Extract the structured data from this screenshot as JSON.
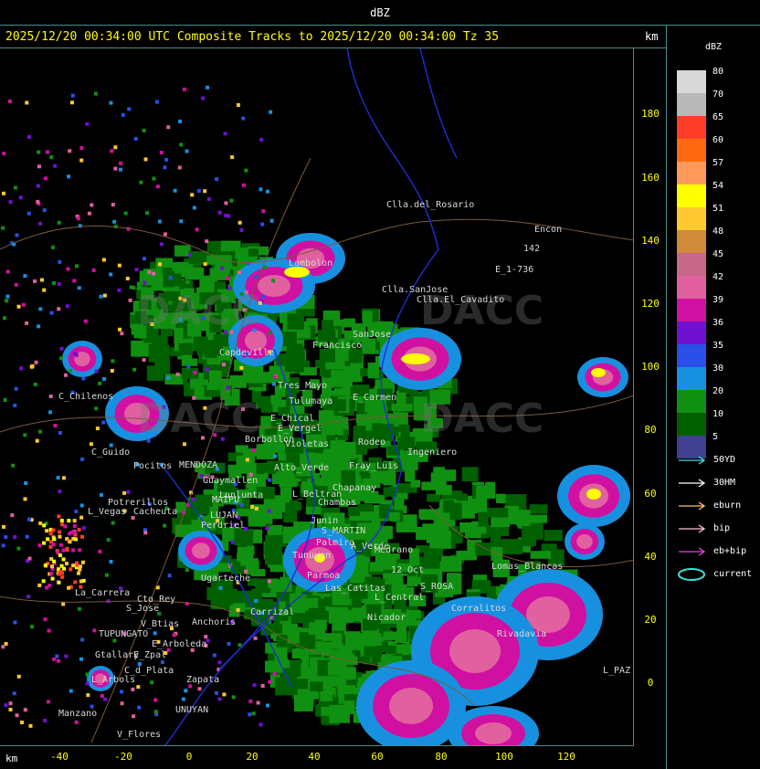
{
  "window": {
    "title": "dBZ"
  },
  "header": {
    "title": "2025/12/20 00:34:00 UTC Composite Tracks to 2025/12/20 00:34:00 Tz 35",
    "unit_top": "km",
    "unit_bottom": "km"
  },
  "axes": {
    "y_ticks": [
      "180",
      "160",
      "140",
      "120",
      "100",
      "80",
      "60",
      "40",
      "20",
      "0"
    ],
    "x_ticks": [
      "-40",
      "-20",
      "0",
      "20",
      "40",
      "60",
      "80",
      "100",
      "120"
    ]
  },
  "legend": {
    "title": "dBZ",
    "levels": [
      {
        "label": "80",
        "color": "#d8d8d8"
      },
      {
        "label": "70",
        "color": "#b8b8b8"
      },
      {
        "label": "65",
        "color": "#ff3c28"
      },
      {
        "label": "60",
        "color": "#ff6a10"
      },
      {
        "label": "57",
        "color": "#ff9a5a"
      },
      {
        "label": "54",
        "color": "#ffff00"
      },
      {
        "label": "51",
        "color": "#ffc830"
      },
      {
        "label": "48",
        "color": "#d08a3a"
      },
      {
        "label": "45",
        "color": "#c86888"
      },
      {
        "label": "42",
        "color": "#e060a0"
      },
      {
        "label": "39",
        "color": "#d010a0"
      },
      {
        "label": "36",
        "color": "#7010d0"
      },
      {
        "label": "35",
        "color": "#2850e8"
      },
      {
        "label": "30",
        "color": "#1890e0"
      },
      {
        "label": "20",
        "color": "#109010"
      },
      {
        "label": "10",
        "color": "#006000"
      },
      {
        "label": "5",
        "color": "#404090"
      }
    ],
    "tracks": [
      {
        "label": "50YD",
        "color": "#40e0e0"
      },
      {
        "label": "30HM",
        "color": "#ffffff"
      },
      {
        "label": "eburn",
        "color": "#ffc070"
      },
      {
        "label": "bip",
        "color": "#ffc0e0"
      },
      {
        "label": "eb+bip",
        "color": "#e040e0"
      },
      {
        "label": "current",
        "color": "#40e0e0"
      }
    ]
  },
  "watermark": {
    "text": "DACC"
  },
  "places": [
    "Clla.del_Rosario",
    "Encon",
    "E_1-736",
    "142",
    "Clla.SanJose",
    "Clla.El_Cavadito",
    "Lambolon",
    "SanJose",
    "Francisco",
    "Capdeville",
    "Tres_Mayo",
    "Tulumaya",
    "E_Carmen",
    "C_Chilenos",
    "E_Chical",
    "E_Vergel",
    "Borbollon",
    "Violetas",
    "Ugarteche",
    "Lunlunta",
    "MAIPU",
    "LUJAN",
    "MENDOZA",
    "Potrerillos",
    "Cacheuta",
    "L_Vegas",
    "C_Guido",
    "Perdriel",
    "La_Carrera",
    "Cto_Rey",
    "S_Jose",
    "Anchoris",
    "V_Btias",
    "TUPUNGATO",
    "E_Arboleda",
    "Gtallary",
    "E_Zpal",
    "C_d_Plata",
    "L_Arbols",
    "Zapata",
    "Manzano",
    "V_Flores",
    "UNUYAN",
    "Carrizal",
    "Chapanay",
    "Chambas",
    "S_MARTIN",
    "A_Verde",
    "Medrano",
    "Lomas_Blancas",
    "L_PAZ",
    "Nicador",
    "S_ROSA",
    "12_Oct",
    "Corralitos",
    "Rivadavia",
    "Parmoa",
    "Las_Catitas",
    "Tunuyan",
    "Guaymallen",
    "Junin",
    "L_Central",
    "Alto_Verde",
    "Palmira",
    "Rodeo",
    "L_Beltran",
    "Fray_Luis",
    "Ingeniero",
    "Pocitos"
  ]
}
